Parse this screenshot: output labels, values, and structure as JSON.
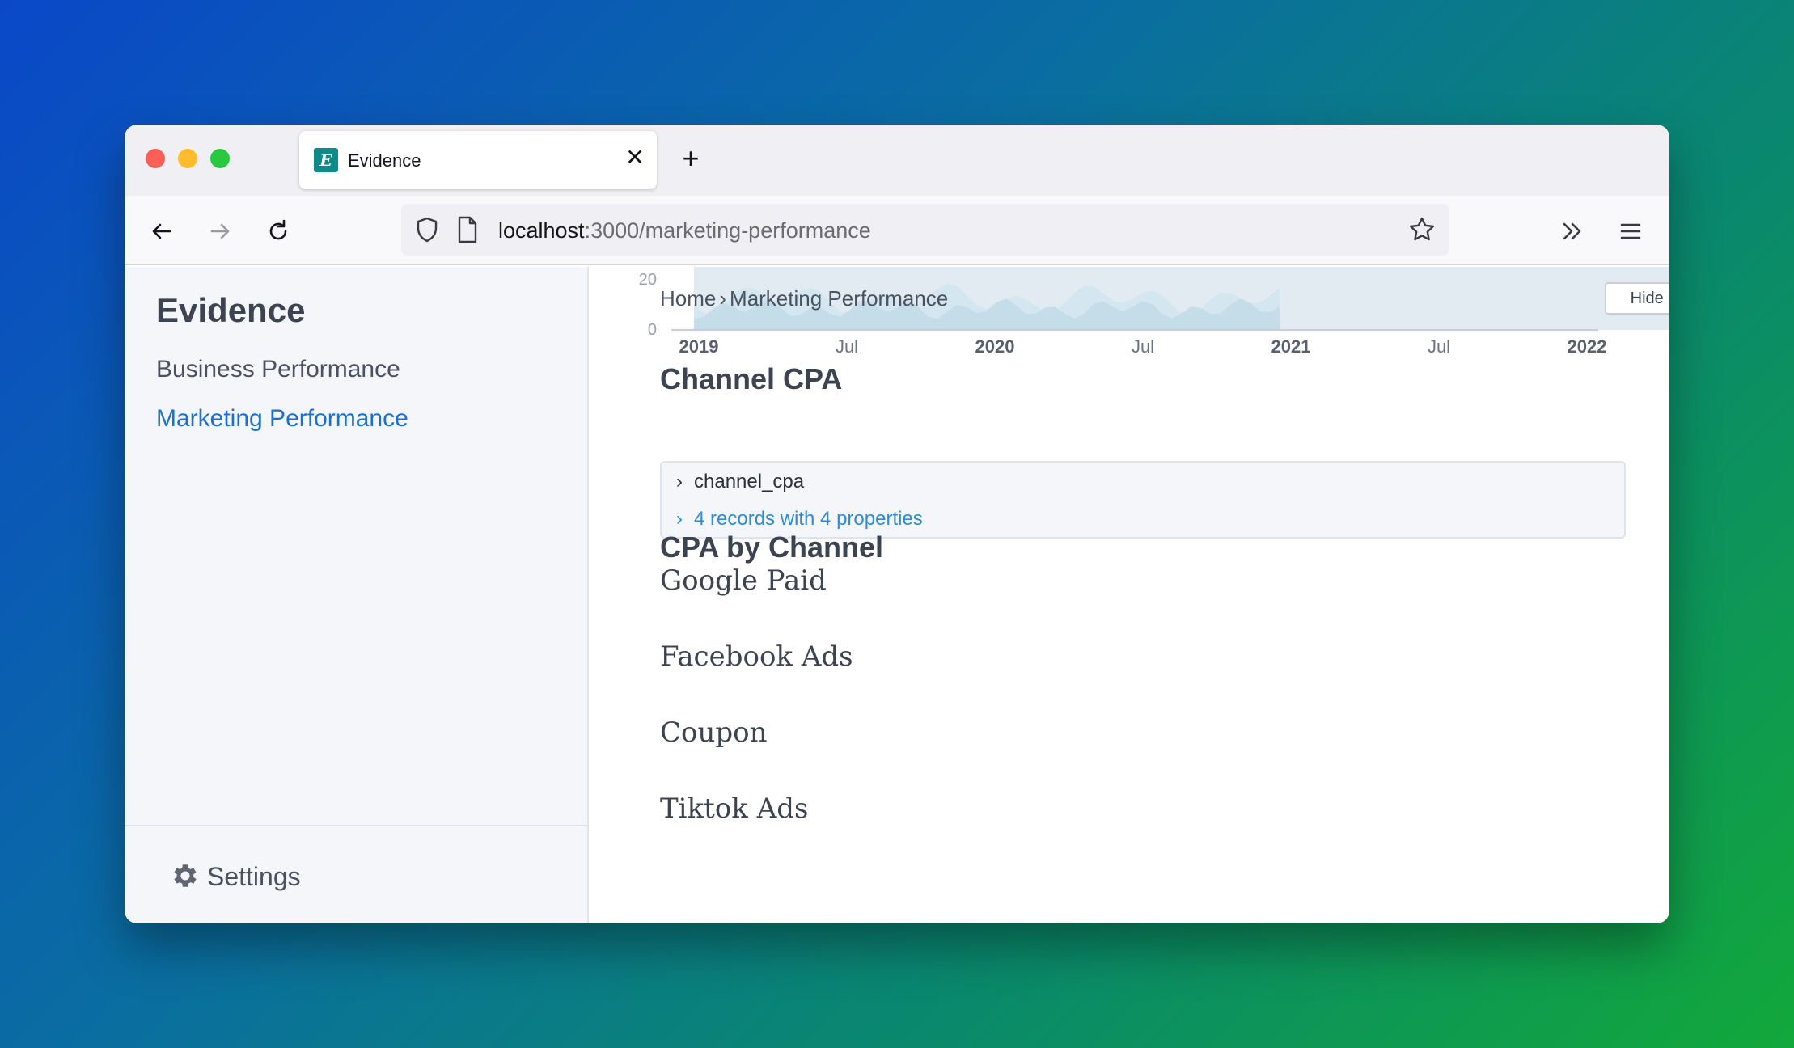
{
  "browser": {
    "tab": {
      "favicon_letter": "E",
      "title": "Evidence",
      "close_glyph": "✕"
    },
    "new_tab_glyph": "+",
    "url": {
      "host": "localhost",
      "rest": ":3000/marketing-performance"
    }
  },
  "sidebar": {
    "brand": "Evidence",
    "items": [
      {
        "label": "Business Performance",
        "active": false
      },
      {
        "label": "Marketing Performance",
        "active": true
      }
    ],
    "settings_label": "Settings"
  },
  "main": {
    "breadcrumb": {
      "home": "Home",
      "sep": "›",
      "current": "Marketing Performance"
    },
    "hide_queries_label": "Hide Queries",
    "chart_ticks": {
      "y": [
        "20",
        "0"
      ],
      "x": [
        {
          "label": "2019",
          "bold": true
        },
        {
          "label": "Jul",
          "bold": false
        },
        {
          "label": "2020",
          "bold": true
        },
        {
          "label": "Jul",
          "bold": false
        },
        {
          "label": "2021",
          "bold": true
        },
        {
          "label": "Jul",
          "bold": false
        },
        {
          "label": "2022",
          "bold": true
        }
      ]
    },
    "section1_title": "Channel CPA",
    "query": {
      "chev": "›",
      "name": "channel_cpa",
      "meta": "4 records with 4 properties"
    },
    "section2_title": "CPA by Channel",
    "channels": [
      "Google Paid",
      "Facebook Ads",
      "Coupon",
      "Tiktok Ads"
    ]
  },
  "colors": {
    "accent": "#1a6fd1",
    "link": "#2e8bd8",
    "text": "#3c4452",
    "sidebar_bg": "#f5f6f9",
    "favicon": "#0d8a8a"
  }
}
